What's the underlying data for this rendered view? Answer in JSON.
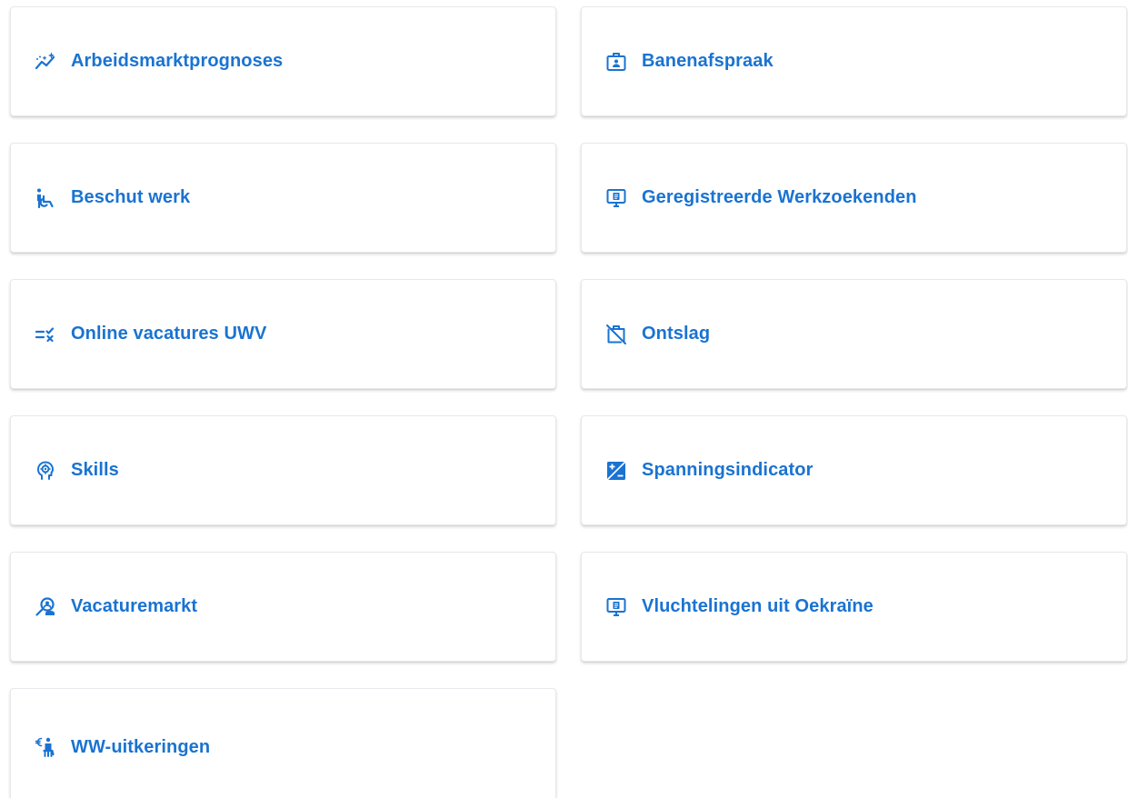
{
  "accent_color": "#1a73d1",
  "cards": [
    {
      "label": "Arbeidsmarktprognoses",
      "icon": "trend-chart-icon"
    },
    {
      "label": "Banenafspraak",
      "icon": "id-badge-briefcase-icon"
    },
    {
      "label": "Beschut werk",
      "icon": "accessibility-icon"
    },
    {
      "label": "Geregistreerde Werkzoekenden",
      "icon": "monitor-document-icon"
    },
    {
      "label": "Online vacatures UWV",
      "icon": "list-check-icon"
    },
    {
      "label": "Ontslag",
      "icon": "briefcase-off-icon"
    },
    {
      "label": "Skills",
      "icon": "head-gear-icon"
    },
    {
      "label": "Spanningsindicator",
      "icon": "plus-minus-square-icon"
    },
    {
      "label": "Vacaturemarkt",
      "icon": "person-search-icon"
    },
    {
      "label": "Vluchtelingen uit Oekraïne",
      "icon": "monitor-document-icon"
    },
    {
      "label": "WW-uitkeringen",
      "icon": "euro-person-icon"
    }
  ]
}
